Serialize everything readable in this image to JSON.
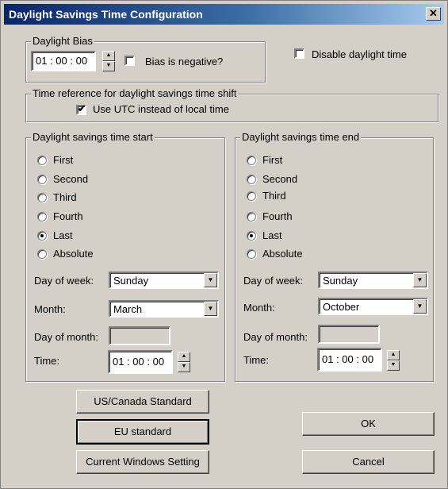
{
  "window": {
    "title": "Daylight Savings Time Configuration",
    "close_glyph": "✕"
  },
  "bias": {
    "legend": "Daylight Bias",
    "value": "01 : 00 : 00",
    "negative_label": "Bias is negative?",
    "negative_checked": false
  },
  "disable": {
    "label": "Disable daylight time",
    "checked": false
  },
  "time_reference": {
    "legend": "Time reference for daylight savings time shift",
    "utc_label": "Use UTC instead of local time",
    "utc_checked": true
  },
  "dst_start": {
    "legend": "Daylight savings time start",
    "options": [
      "First",
      "Second",
      "Third",
      "Fourth",
      "Last",
      "Absolute"
    ],
    "selected": "Last",
    "day_of_week_label": "Day of week:",
    "day_of_week": "Sunday",
    "month_label": "Month:",
    "month": "March",
    "day_of_month_label": "Day of month:",
    "day_of_month": "",
    "time_label": "Time:",
    "time": "01 : 00 : 00"
  },
  "dst_end": {
    "legend": "Daylight savings time end",
    "options": [
      "First",
      "Second",
      "Third",
      "Fourth",
      "Last",
      "Absolute"
    ],
    "selected": "Last",
    "day_of_week_label": "Day of week:",
    "day_of_week": "Sunday",
    "month_label": "Month:",
    "month": "October",
    "day_of_month_label": "Day of month:",
    "day_of_month": "",
    "time_label": "Time:",
    "time": "01 : 00 : 00"
  },
  "buttons": {
    "us_canada": "US/Canada Standard",
    "eu": "EU standard",
    "current_windows": "Current Windows Setting",
    "ok": "OK",
    "cancel": "Cancel"
  },
  "icons": {
    "spin_up": "▲",
    "spin_down": "▼",
    "combo_arrow": "▼",
    "check": "✔"
  }
}
